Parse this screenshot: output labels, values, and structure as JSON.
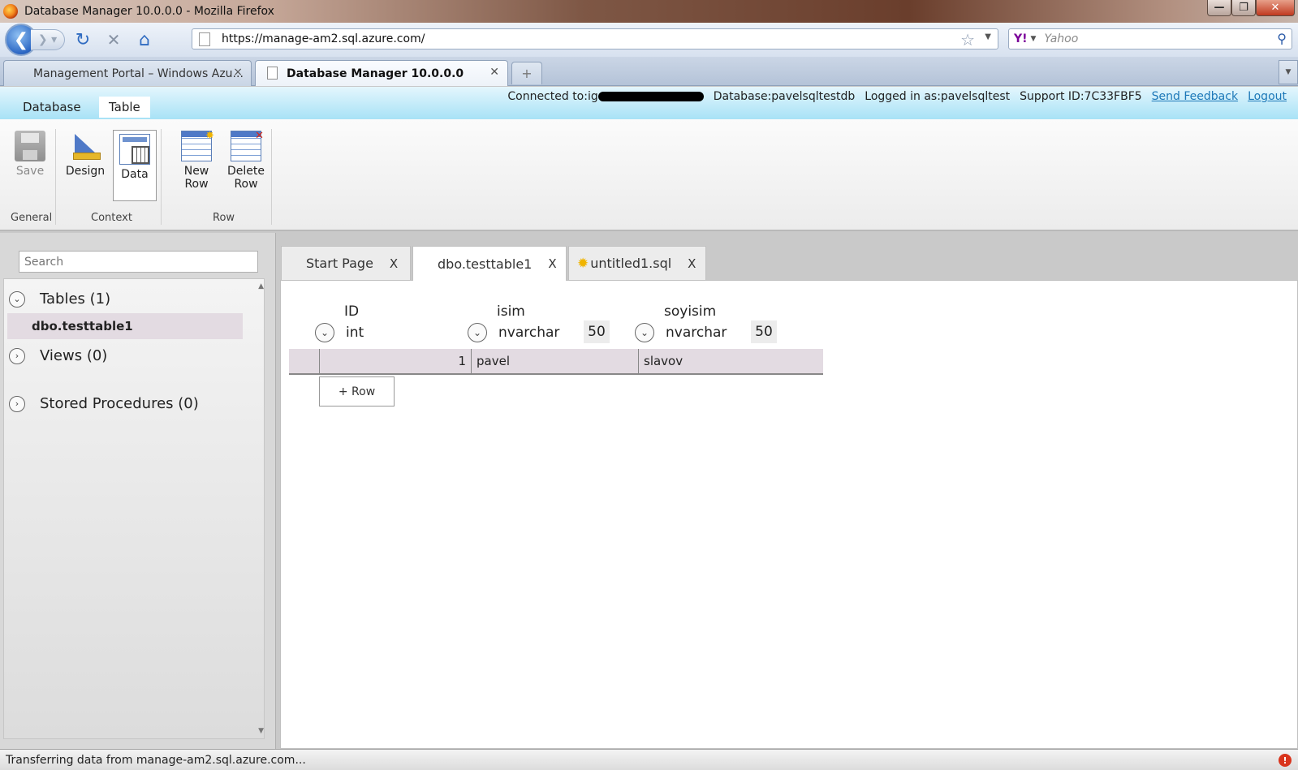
{
  "window": {
    "title": "Database Manager 10.0.0.0 - Mozilla Firefox",
    "minimize": "—",
    "maximize": "❐",
    "close": "✕"
  },
  "nav": {
    "url": "https://manage-am2.sql.azure.com/",
    "search_placeholder": "Yahoo",
    "search_engine_logo": "Y!"
  },
  "browser_tabs": [
    {
      "label": "Management Portal – Windows Azu...",
      "close": "×"
    },
    {
      "label": "Database Manager 10.0.0.0",
      "close": "✕"
    }
  ],
  "header": {
    "menus": [
      "Database",
      "Table"
    ],
    "connected_to_label": "Connected to:ig",
    "database": "Database:pavelsqltestdb",
    "logged_in": "Logged in as:pavelsqltest",
    "support_id": "Support ID:7C33FBF5",
    "send_feedback": "Send Feedback",
    "logout": "Logout"
  },
  "ribbon": {
    "buttons": {
      "save": "Save",
      "design": "Design",
      "data": "Data",
      "new_row_1": "New",
      "new_row_2": "Row",
      "delete_row_1": "Delete",
      "delete_row_2": "Row"
    },
    "groups": {
      "general": "General",
      "context": "Context",
      "row": "Row"
    }
  },
  "sidebar": {
    "search_placeholder": "Search",
    "tree": {
      "tables": "Tables (1)",
      "tables_child": "dbo.testtable1",
      "views": "Views (0)",
      "stored_procedures": "Stored Procedures (0)"
    }
  },
  "doc_tabs": [
    {
      "label": "Start Page",
      "close": "X"
    },
    {
      "label": "dbo.testtable1",
      "close": "X"
    },
    {
      "label": "untitled1.sql",
      "close": "X"
    }
  ],
  "table": {
    "columns": [
      {
        "name": "ID",
        "type": "int",
        "length": ""
      },
      {
        "name": "isim",
        "type": "nvarchar",
        "length": "50"
      },
      {
        "name": "soyisim",
        "type": "nvarchar",
        "length": "50"
      }
    ],
    "rows": [
      {
        "id": "1",
        "isim": "pavel",
        "soyisim": "slavov"
      }
    ],
    "add_row_label": "+ Row"
  },
  "status": {
    "text": "Transferring data from manage-am2.sql.azure.com..."
  },
  "colors": {
    "header_gradient_top": "#e4f6fd",
    "header_gradient_bottom": "#a8e2f6",
    "link": "#1d78b8",
    "selected_row": "#e3dbe2"
  }
}
